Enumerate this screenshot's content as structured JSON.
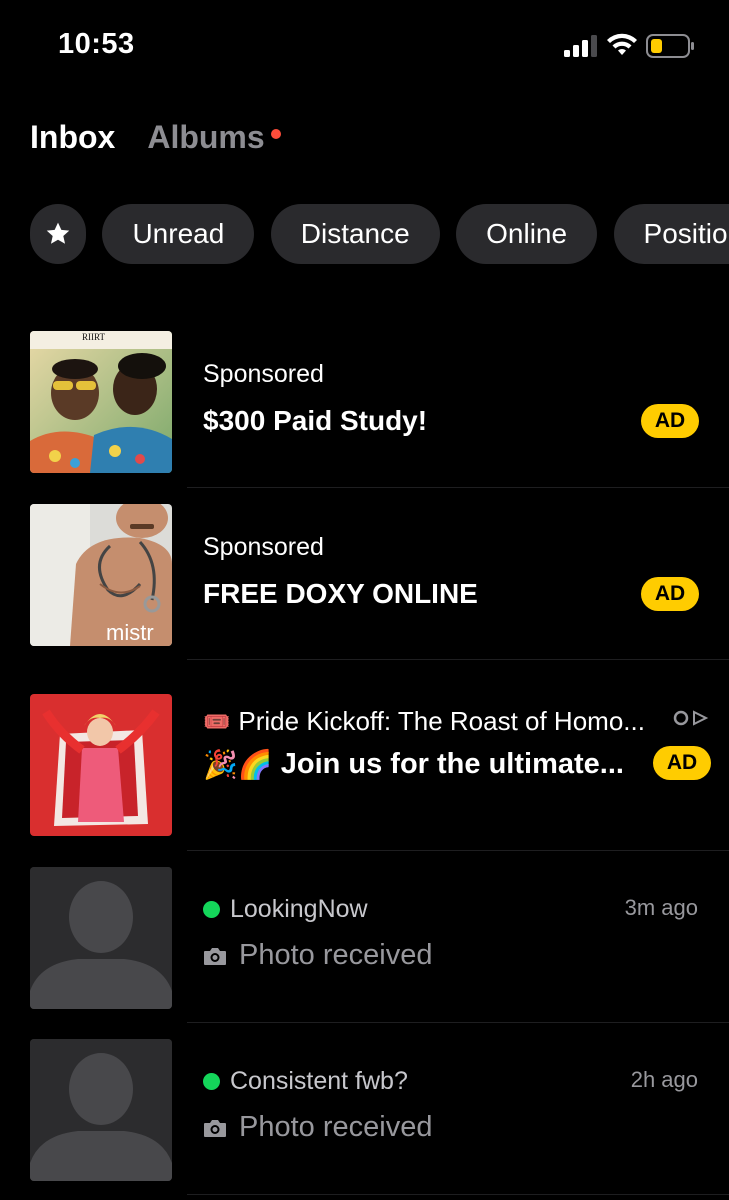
{
  "status_bar": {
    "time": "10:53",
    "battery_color": "#ffcc00"
  },
  "tabs": [
    {
      "label": "Inbox",
      "active": true
    },
    {
      "label": "Albums",
      "active": false,
      "has_dot": true
    }
  ],
  "filters": {
    "favorites_icon": "star-icon",
    "chips": [
      "Unread",
      "Distance",
      "Online",
      "Position"
    ]
  },
  "conversations": [
    {
      "type": "ad",
      "label": "Sponsored",
      "title": "$300 Paid Study!",
      "badge": "AD",
      "thumb_caption": "RIIRT"
    },
    {
      "type": "ad",
      "label": "Sponsored",
      "title": "FREE DOXY ONLINE",
      "badge": "AD",
      "thumb_caption": "mistr"
    },
    {
      "type": "event_ad",
      "title_emoji": "🎟️",
      "title": "Pride Kickoff: The Roast of Homo...",
      "body_emoji": "🎉🌈",
      "body": "Join us for the ultimate...",
      "badge": "AD",
      "ad_choices_icon": "adchoices-icon"
    },
    {
      "type": "message",
      "name": "LookingNow",
      "online": true,
      "preview": "Photo received",
      "time": "3m ago"
    },
    {
      "type": "message",
      "name": "Consistent fwb?",
      "online": true,
      "preview": "Photo received",
      "time": "2h ago"
    }
  ],
  "colors": {
    "accent_yellow": "#ffcc00",
    "online_green": "#14d65a",
    "notification_red": "#ff4d3a",
    "chip_bg": "#2a2a2d"
  }
}
